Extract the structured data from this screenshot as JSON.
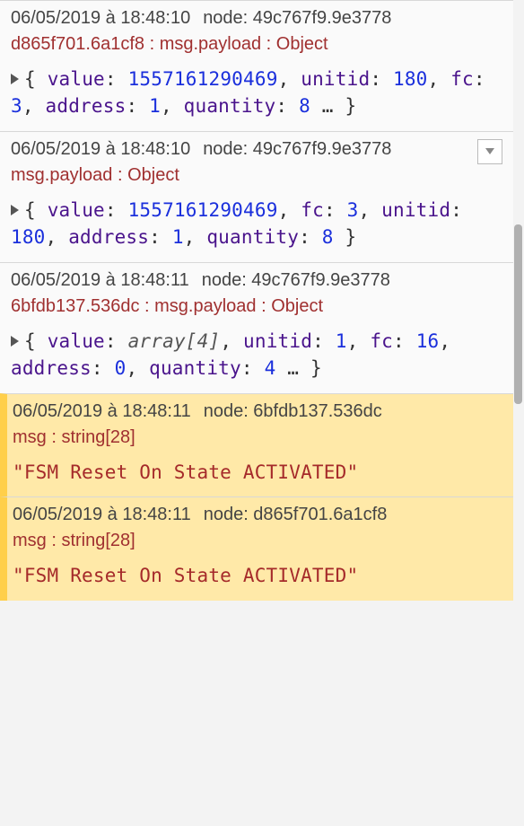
{
  "messages": [
    {
      "timestamp": "06/05/2019 à 18:48:10",
      "node_label": "node: 49c767f9.9e3778",
      "topic_prefix": "d865f701.6a1cf8 : ",
      "type_text": "msg.payload : Object",
      "expand_visible": false,
      "warn": false,
      "payload_kind": "obj",
      "obj": [
        {
          "k": "value",
          "v": "1557161290469",
          "t": "num"
        },
        {
          "k": "unitid",
          "v": "180",
          "t": "num"
        },
        {
          "k": "fc",
          "v": "3",
          "t": "num"
        },
        {
          "k": "address",
          "v": "1",
          "t": "num"
        },
        {
          "k": "quantity",
          "v": "8",
          "t": "num"
        }
      ],
      "ellipsis": true
    },
    {
      "timestamp": "06/05/2019 à 18:48:10",
      "node_label": "node: 49c767f9.9e3778",
      "topic_prefix": "",
      "type_text": "msg.payload : Object",
      "expand_visible": true,
      "warn": false,
      "payload_kind": "obj",
      "obj": [
        {
          "k": "value",
          "v": "1557161290469",
          "t": "num"
        },
        {
          "k": "fc",
          "v": "3",
          "t": "num"
        },
        {
          "k": "unitid",
          "v": "180",
          "t": "num"
        },
        {
          "k": "address",
          "v": "1",
          "t": "num"
        },
        {
          "k": "quantity",
          "v": "8",
          "t": "num"
        }
      ],
      "ellipsis": false
    },
    {
      "timestamp": "06/05/2019 à 18:48:11",
      "node_label": "node: 49c767f9.9e3778",
      "topic_prefix": "6bfdb137.536dc : ",
      "type_text": "msg.payload : Object",
      "expand_visible": false,
      "warn": false,
      "payload_kind": "obj",
      "obj": [
        {
          "k": "value",
          "v": "array[4]",
          "t": "ital"
        },
        {
          "k": "unitid",
          "v": "1",
          "t": "num"
        },
        {
          "k": "fc",
          "v": "16",
          "t": "num"
        },
        {
          "k": "address",
          "v": "0",
          "t": "num"
        },
        {
          "k": "quantity",
          "v": "4",
          "t": "num"
        }
      ],
      "ellipsis": true
    },
    {
      "timestamp": "06/05/2019 à 18:48:11",
      "node_label": "node: 6bfdb137.536dc",
      "topic_prefix": "",
      "type_text": "msg : string[28]",
      "expand_visible": false,
      "warn": true,
      "payload_kind": "str",
      "str": "\"FSM Reset On State ACTIVATED\""
    },
    {
      "timestamp": "06/05/2019 à 18:48:11",
      "node_label": "node: d865f701.6a1cf8",
      "topic_prefix": "",
      "type_text": "msg : string[28]",
      "expand_visible": false,
      "warn": true,
      "payload_kind": "str",
      "str": "\"FSM Reset On State ACTIVATED\""
    }
  ]
}
